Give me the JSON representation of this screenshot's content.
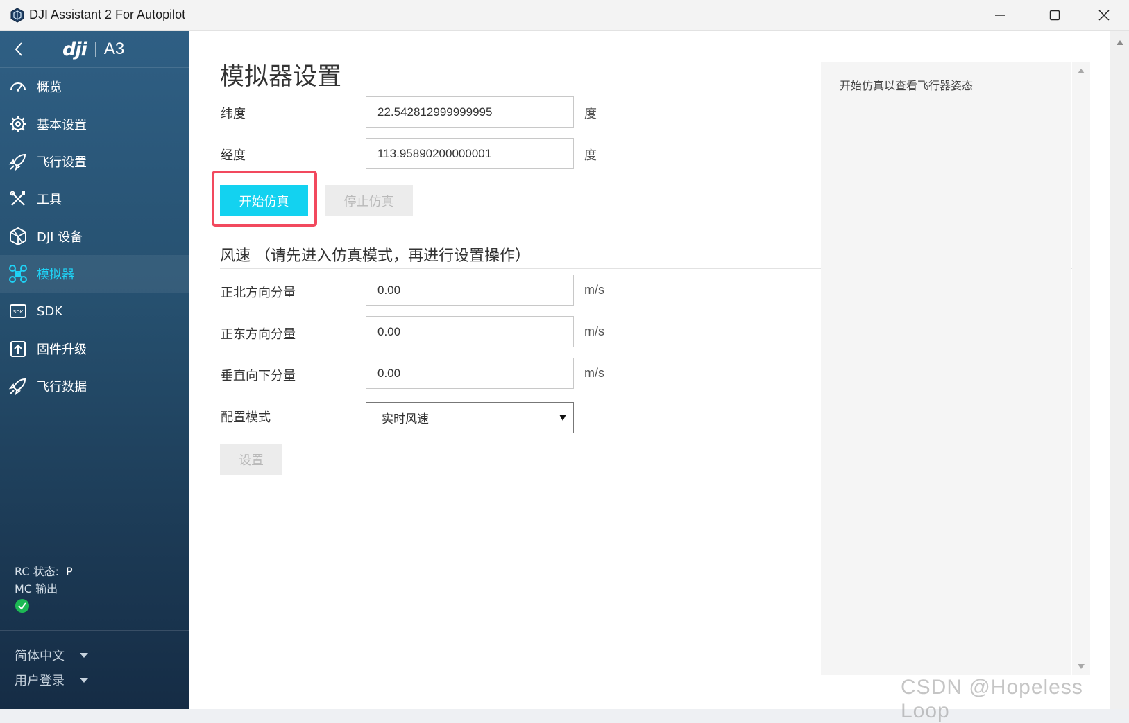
{
  "window": {
    "title": "DJI Assistant 2 For Autopilot"
  },
  "sidebar": {
    "brand_logo": "dji",
    "brand_model": "A3",
    "items": [
      {
        "label": "概览",
        "icon": "gauge-icon"
      },
      {
        "label": "基本设置",
        "icon": "gear-icon"
      },
      {
        "label": "飞行设置",
        "icon": "rocket-icon"
      },
      {
        "label": "工具",
        "icon": "tools-icon"
      },
      {
        "label": "DJI 设备",
        "icon": "device-icon"
      },
      {
        "label": "模拟器",
        "icon": "drone-icon"
      },
      {
        "label": "SDK",
        "icon": "sdk-icon"
      },
      {
        "label": "固件升级",
        "icon": "firmware-icon"
      },
      {
        "label": "飞行数据",
        "icon": "rocket-icon"
      }
    ],
    "active_item": "模拟器",
    "active_color": "#1fd2f5",
    "status": {
      "rc_label": "RC 状态:",
      "rc_value": "P",
      "mc_label": "MC 输出",
      "mc_state": "ok",
      "ok_color": "#1db954"
    },
    "language": "简体中文",
    "login": "用户登录"
  },
  "main": {
    "title": "模拟器设置",
    "latitude": {
      "label": "纬度",
      "value": "22.542812999999995",
      "unit": "度"
    },
    "longitude": {
      "label": "经度",
      "value": "113.95890200000001",
      "unit": "度"
    },
    "start_button": "开始仿真",
    "stop_button": "停止仿真",
    "start_color": "#13d2f0",
    "highlight_color": "#f2495e",
    "wind_section": "风速   （请先进入仿真模式，再进行设置操作）",
    "wind_north": {
      "label": "正北方向分量",
      "value": "0.00",
      "unit": "m/s"
    },
    "wind_east": {
      "label": "正东方向分量",
      "value": "0.00",
      "unit": "m/s"
    },
    "wind_down": {
      "label": "垂直向下分量",
      "value": "0.00",
      "unit": "m/s"
    },
    "config_mode": {
      "label": "配置模式",
      "selected": "实时风速"
    },
    "set_button": "设置"
  },
  "right_panel": {
    "hint": "开始仿真以查看飞行器姿态"
  },
  "watermark": "CSDN @Hopeless Loop"
}
